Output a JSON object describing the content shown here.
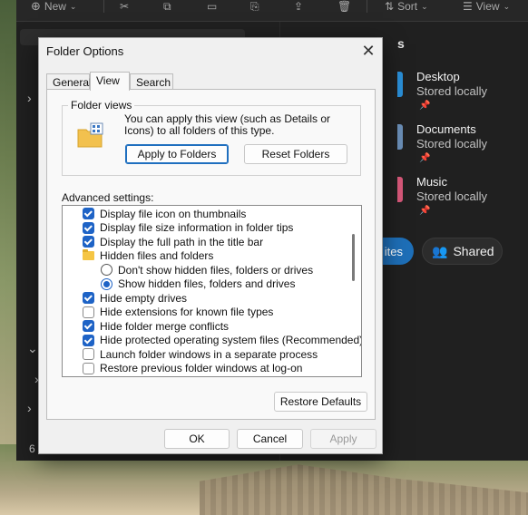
{
  "explorer": {
    "toolbar": {
      "new_label": "New",
      "sort_label": "Sort",
      "view_label": "View"
    },
    "quick_access_title": "s",
    "folders": [
      {
        "name": "Desktop",
        "status": "Stored locally",
        "color": "#2a8fd8"
      },
      {
        "name": "Documents",
        "status": "Stored locally",
        "color": "#6b8fb8"
      },
      {
        "name": "Music",
        "status": "Stored locally",
        "color": "#d8587a"
      }
    ],
    "favorites_pill": "ites",
    "shared_pill": "Shared",
    "side_count": "6"
  },
  "dialog": {
    "title": "Folder Options",
    "tabs": [
      "General",
      "View",
      "Search"
    ],
    "active_tab": "View",
    "folder_views": {
      "label": "Folder views",
      "description": "You can apply this view (such as Details or Icons) to all folders of this type.",
      "apply_button": "Apply to Folders",
      "reset_button": "Reset Folders"
    },
    "advanced_label": "Advanced settings:",
    "advanced_items": [
      {
        "type": "checkbox",
        "checked": true,
        "label": "Display file icon on thumbnails"
      },
      {
        "type": "checkbox",
        "checked": true,
        "label": "Display file size information in folder tips"
      },
      {
        "type": "checkbox",
        "checked": true,
        "label": "Display the full path in the title bar"
      },
      {
        "type": "folder",
        "label": "Hidden files and folders"
      },
      {
        "type": "radio",
        "checked": false,
        "label": "Don't show hidden files, folders or drives"
      },
      {
        "type": "radio",
        "checked": true,
        "label": "Show hidden files, folders and drives"
      },
      {
        "type": "checkbox",
        "checked": true,
        "label": "Hide empty drives"
      },
      {
        "type": "checkbox",
        "checked": false,
        "label": "Hide extensions for known file types"
      },
      {
        "type": "checkbox",
        "checked": true,
        "label": "Hide folder merge conflicts"
      },
      {
        "type": "checkbox",
        "checked": true,
        "label": "Hide protected operating system files (Recommended)"
      },
      {
        "type": "checkbox",
        "checked": false,
        "label": "Launch folder windows in a separate process"
      },
      {
        "type": "checkbox",
        "checked": false,
        "label": "Restore previous folder windows at log-on"
      }
    ],
    "restore_defaults_button": "Restore Defaults",
    "ok_button": "OK",
    "cancel_button": "Cancel",
    "apply_button": "Apply"
  }
}
